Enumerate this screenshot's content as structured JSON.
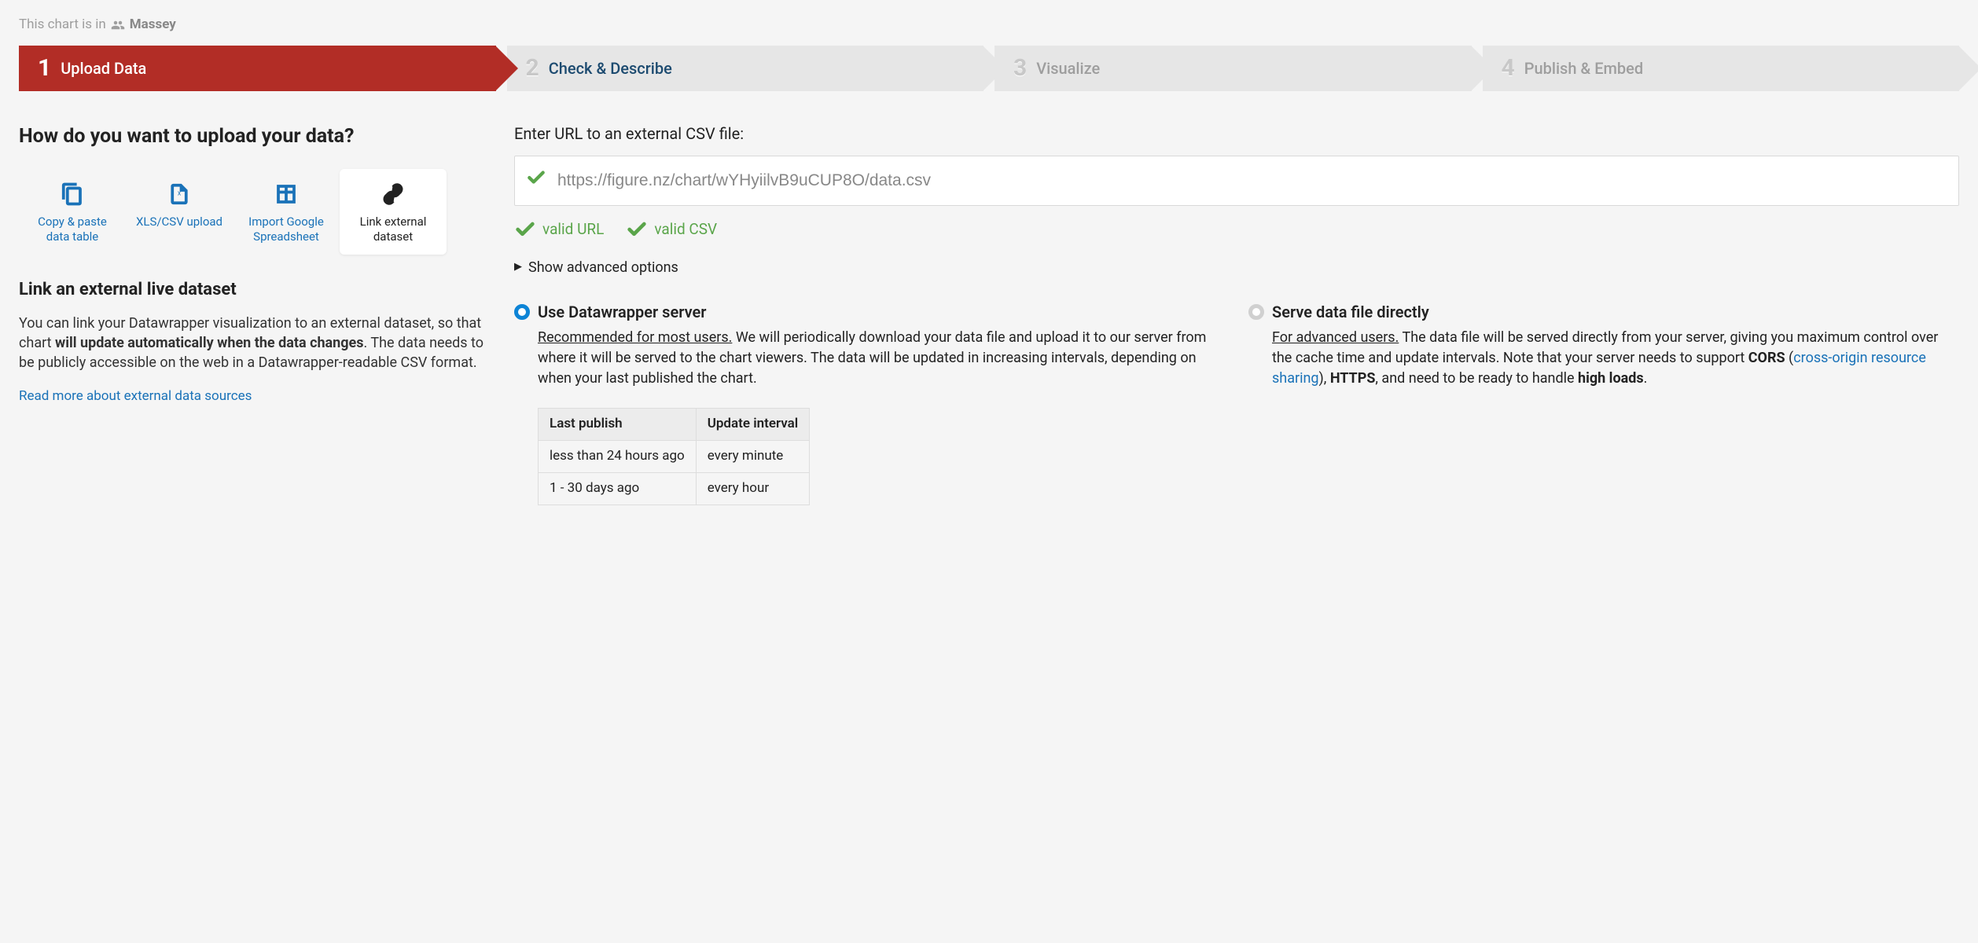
{
  "header": {
    "prefix": "This chart is in",
    "team": "Massey"
  },
  "steps": [
    {
      "num": "1",
      "label": "Upload Data",
      "active": true
    },
    {
      "num": "2",
      "label": "Check & Describe",
      "active": false
    },
    {
      "num": "3",
      "label": "Visualize",
      "active": false,
      "disabled": true
    },
    {
      "num": "4",
      "label": "Publish & Embed",
      "active": false,
      "disabled": true
    }
  ],
  "left": {
    "title": "How do you want to upload your data?",
    "methods": [
      {
        "id": "copy-paste",
        "label": "Copy & paste data table"
      },
      {
        "id": "xls-csv",
        "label": "XLS/CSV upload"
      },
      {
        "id": "google",
        "label": "Import Google Spreadsheet"
      },
      {
        "id": "link-external",
        "label": "Link external dataset",
        "selected": true
      }
    ],
    "subTitle": "Link an external live dataset",
    "desc_pre": "You can link your Datawrapper visualization to an external dataset, so that chart ",
    "desc_bold": "will update automatically when the data changes",
    "desc_post": ". The data needs to be publicly accessible on the web in a Datawrapper-readable CSV format.",
    "readMore": "Read more about external data sources"
  },
  "right": {
    "fieldLabel": "Enter URL to an external CSV file:",
    "urlValue": "https://figure.nz/chart/wYHyiilvB9uCUP8O/data.csv",
    "validUrl": "valid URL",
    "validCsv": "valid CSV",
    "advancedToggle": "Show advanced options",
    "radioA": {
      "title": "Use Datawrapper server",
      "lead": "Recommended for most users.",
      "body": " We will periodically download your data file and upload it to our server from where it will be served to the chart viewers. The data will be updated in increasing intervals, depending on when your last published the chart."
    },
    "radioB": {
      "title": "Serve data file directly",
      "lead": "For advanced users.",
      "body1": " The data file will be served directly from your server, giving you maximum control over the cache time and update intervals. Note that your server needs to support ",
      "cors": "CORS",
      "paren_open": " (",
      "corsLink": "cross-origin resource sharing",
      "paren_close": "), ",
      "https": "HTTPS",
      "body2": ", and need to be ready to handle ",
      "highLoads": "high loads",
      "period": "."
    },
    "table": {
      "h1": "Last publish",
      "h2": "Update interval",
      "rows": [
        {
          "publish": "less than 24 hours ago",
          "interval": "every minute"
        },
        {
          "publish": "1 - 30 days ago",
          "interval": "every hour"
        }
      ]
    }
  }
}
